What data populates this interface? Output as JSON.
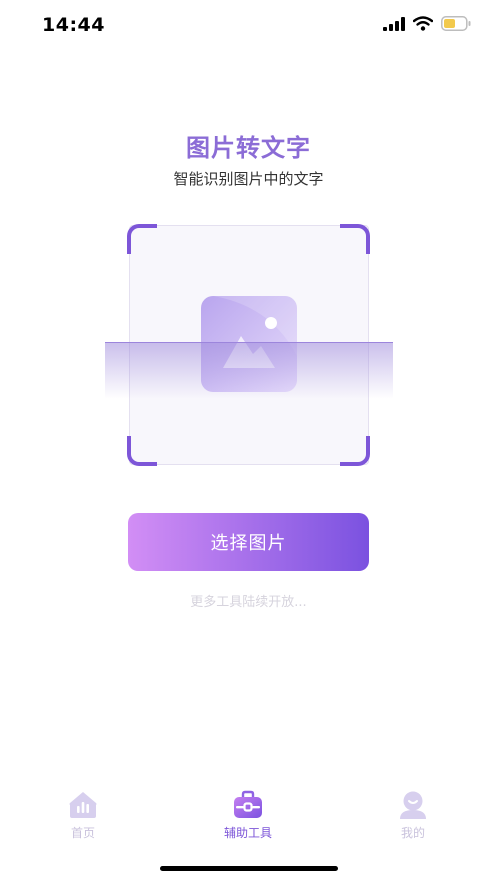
{
  "status_bar": {
    "time": "14:44"
  },
  "header": {
    "title": "图片转文字",
    "subtitle": "智能识别图片中的文字"
  },
  "scanner": {
    "placeholder_icon": "image-icon"
  },
  "actions": {
    "select_label": "选择图片"
  },
  "footer_note": "更多工具陆续开放...",
  "tab_bar": {
    "tabs": [
      {
        "label": "首页",
        "icon": "home-chart-icon",
        "active": false
      },
      {
        "label": "辅助工具",
        "icon": "toolbox-icon",
        "active": true
      },
      {
        "label": "我的",
        "icon": "user-icon",
        "active": false
      }
    ]
  },
  "colors": {
    "accent": "#7d56d8",
    "title": "#8b6cd6",
    "gradient_start": "#d28ef5",
    "gradient_end": "#7b52e0",
    "battery": "#f2c94c"
  }
}
